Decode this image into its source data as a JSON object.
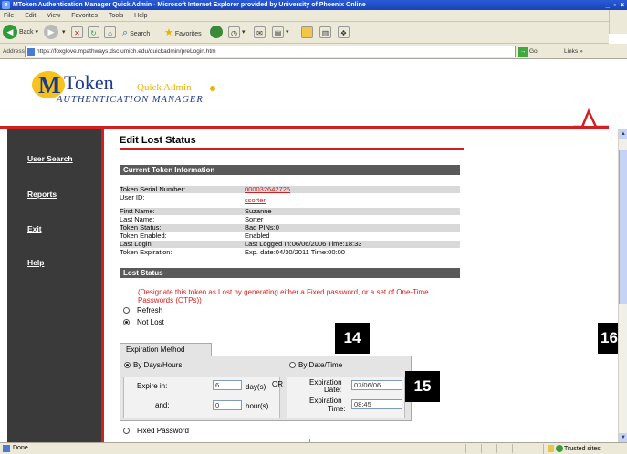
{
  "window": {
    "title": "MToken Authentication Manager Quick Admin - Microsoft Internet Explorer provided by University of Phoenix Online",
    "controls": "_ ▫ ×"
  },
  "menu": [
    "File",
    "Edit",
    "View",
    "Favorites",
    "Tools",
    "Help"
  ],
  "toolbar": {
    "back": "Back",
    "search": "Search",
    "favorites": "Favorites",
    "go": "Go",
    "links": "Links"
  },
  "address": {
    "label": "Address",
    "url": "https://foxglove.mpathways.dsc.umich.edu/quickadmin/preLogin.htm"
  },
  "banner": {
    "logo_letter": "M",
    "brand": "Token",
    "quick_admin": "Quick Admin",
    "subtitle": "AUTHENTICATION MANAGER"
  },
  "sidebar": {
    "items": [
      {
        "label": "User Search"
      },
      {
        "label": "Reports"
      },
      {
        "label": "Exit"
      },
      {
        "label": "Help"
      }
    ]
  },
  "page": {
    "title": "Edit Lost Status",
    "token_section": "Current Token Information",
    "lost_section": "Lost Status"
  },
  "token_info": [
    {
      "label": "Token Serial Number:",
      "value": "000032642726",
      "link": true
    },
    {
      "label": "User ID:",
      "value": "ssorter",
      "link": true
    },
    {
      "label": "First Name:",
      "value": "Suzanne"
    },
    {
      "label": "Last Name:",
      "value": "Sorter"
    },
    {
      "label": "Token Status:",
      "value": "Bad PINs:0"
    },
    {
      "label": "Token Enabled:",
      "value": "Enabled"
    },
    {
      "label": "Last Login:",
      "value": "Last Logged In:06/06/2006 Time:18:33"
    },
    {
      "label": "Token Expiration:",
      "value": "Exp. date:04/30/2011 Time:00:00"
    }
  ],
  "lost_status": {
    "warning": "(Designate this token as Lost by generating either a Fixed password, or a set of One-Time Passwords (OTPs))",
    "refresh": "Refresh",
    "not_lost": "Not Lost",
    "fixed_password": "Fixed Password"
  },
  "expiration": {
    "tab": "Expiration Method",
    "by_days": "By Days/Hours",
    "by_date": "By Date/Time",
    "expire_in": "Expire in:",
    "days_value": "6",
    "days_unit": "day(s)",
    "or": "OR",
    "and": "and:",
    "hours_value": "0",
    "hours_unit": "hour(s)",
    "exp_date_label_1": "Expiration",
    "exp_date_label_2": "Date:",
    "exp_date_value": "07/06/06",
    "exp_time_label_1": "Expiration",
    "exp_time_label_2": "Time:",
    "exp_time_value": "08:45"
  },
  "callouts": [
    "14",
    "15",
    "16"
  ],
  "status": {
    "text": "Done",
    "zone": "Trusted sites"
  }
}
